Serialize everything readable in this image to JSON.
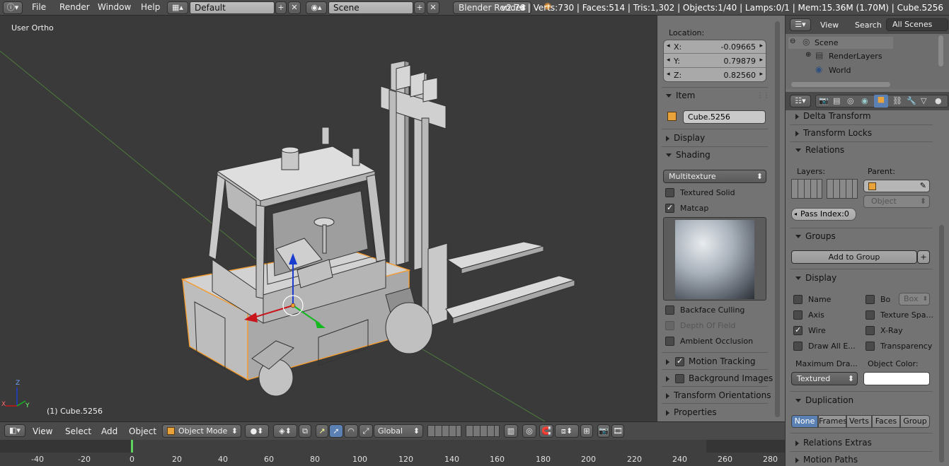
{
  "topbar": {
    "menus": [
      "File",
      "Render",
      "Window",
      "Help"
    ],
    "screen_layout": "Default",
    "scene": "Scene",
    "render_engine": "Blender Render",
    "stats": "v2.76 | Verts:730 | Faces:514 | Tris:1,302 | Objects:1/40 | Lamps:0/1 | Mem:15.36M (1.70M) | Cube.5256"
  },
  "viewport": {
    "view_label": "User Ortho",
    "object_label": "(1) Cube.5256",
    "axis_x": "X",
    "axis_y": "Y",
    "axis_z": "Z"
  },
  "npanel": {
    "location_label": "Location:",
    "x_label": "X:",
    "x_value": "-0.09665",
    "y_label": "Y:",
    "y_value": "0.79879",
    "z_label": "Z:",
    "z_value": "0.82560",
    "item_header": "Item",
    "item_name": "Cube.5256",
    "display_header": "Display",
    "shading_header": "Shading",
    "shading_mode": "Multitexture",
    "textured_solid": "Textured Solid",
    "matcap": "Matcap",
    "backface_culling": "Backface Culling",
    "depth_of_field": "Depth Of Field",
    "ambient_occlusion": "Ambient Occlusion",
    "motion_tracking": "Motion Tracking",
    "background_images": "Background Images",
    "transform_orientations": "Transform Orientations",
    "properties": "Properties"
  },
  "outliner": {
    "view": "View",
    "search": "Search",
    "all_scenes": "All Scenes",
    "items": [
      "Scene",
      "RenderLayers",
      "World"
    ]
  },
  "props": {
    "delta_transform": "Delta Transform",
    "transform_locks": "Transform Locks",
    "relations": "Relations",
    "layers": "Layers:",
    "parent": "Parent:",
    "parent_type": "Object",
    "pass_index": "Pass Index:0",
    "groups": "Groups",
    "add_to_group": "Add to Group",
    "display": "Display",
    "name": "Name",
    "bo": "Bo",
    "box": "Box",
    "axis": "Axis",
    "texture_space": "Texture Spa...",
    "wire": "Wire",
    "xray": "X-Ray",
    "draw_all_edges": "Draw All E...",
    "transparency": "Transparency",
    "max_draw": "Maximum Dra...",
    "object_color": "Object Color:",
    "textured": "Textured",
    "duplication": "Duplication",
    "dup_options": [
      "None",
      "Frames",
      "Verts",
      "Faces",
      "Group"
    ],
    "relations_extras": "Relations Extras",
    "motion_paths": "Motion Paths"
  },
  "bottombar": {
    "view": "View",
    "select": "Select",
    "add": "Add",
    "object": "Object",
    "mode": "Object Mode",
    "orientation": "Global"
  },
  "timeline": {
    "ticks": [
      "-40",
      "-20",
      "0",
      "20",
      "40",
      "60",
      "80",
      "100",
      "120",
      "140",
      "160",
      "180",
      "200",
      "220",
      "240",
      "260",
      "280"
    ]
  },
  "colors": {
    "selection": "#f39c32",
    "matcap_dark": "#5f6670",
    "accent_blue": "#5a80b4"
  }
}
